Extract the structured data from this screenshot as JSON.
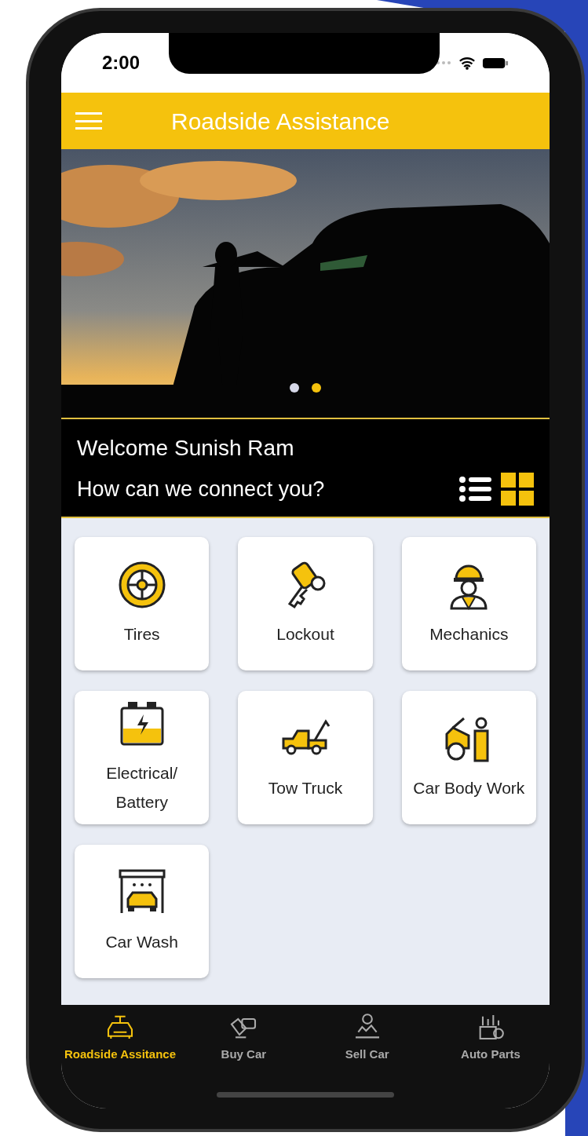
{
  "status_bar": {
    "time": "2:00"
  },
  "header": {
    "title": "Roadside Assistance"
  },
  "hero": {
    "kind": "picture",
    "dots": [
      {
        "selected": false
      },
      {
        "selected": true
      }
    ]
  },
  "welcome": {
    "greeting": "Welcome Sunish Ram",
    "prompt": "How can we connect you?",
    "views": [
      {
        "kind": "list",
        "selected": false
      },
      {
        "kind": "grid",
        "selected": true
      }
    ]
  },
  "services": [
    {
      "label": "Tires"
    },
    {
      "label": "Lockout"
    },
    {
      "label": "Mechanics"
    },
    {
      "label": "Electrical/ Battery"
    },
    {
      "label": "Tow Truck"
    },
    {
      "label": "Car Body Work"
    },
    {
      "label": "Car Wash"
    }
  ],
  "tabs": [
    {
      "label": "Roadside Assitance",
      "selected": true
    },
    {
      "label": "Buy Car",
      "selected": false
    },
    {
      "label": "Sell Car",
      "selected": false
    },
    {
      "label": "Auto Parts",
      "selected": false
    }
  ]
}
